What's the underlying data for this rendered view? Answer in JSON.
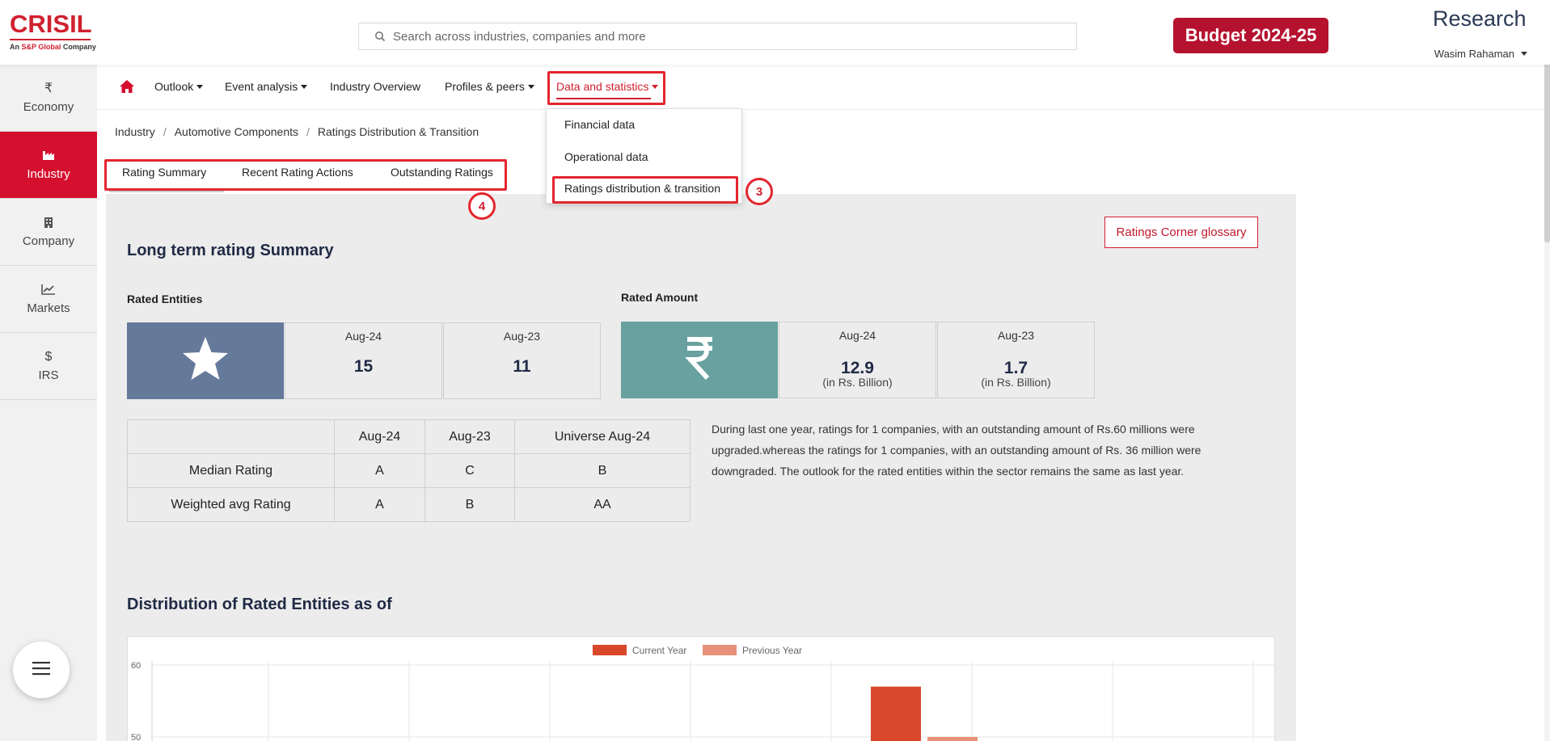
{
  "header": {
    "logo_text": "CRISIL",
    "logo_sub_prefix": "An ",
    "logo_sub_brand": "S&P Global",
    "logo_sub_suffix": " Company",
    "search_placeholder": "Search across industries, companies and more",
    "budget_label": "Budget 2024-25",
    "research_label": "Research",
    "user_name": "Wasim Rahaman"
  },
  "sidebar": {
    "items": [
      {
        "label": "Economy",
        "icon": "₹"
      },
      {
        "label": "Industry",
        "icon": "factory"
      },
      {
        "label": "Company",
        "icon": "building"
      },
      {
        "label": "Markets",
        "icon": "chart-line"
      },
      {
        "label": "IRS",
        "icon": "$"
      }
    ],
    "active": "Industry"
  },
  "nav": {
    "items": [
      {
        "label": "Outlook"
      },
      {
        "label": "Event analysis"
      },
      {
        "label": "Industry Overview"
      },
      {
        "label": "Profiles & peers"
      },
      {
        "label": "Data and statistics"
      }
    ],
    "active": "Data and statistics"
  },
  "dropdown": {
    "items": [
      {
        "label": "Financial data"
      },
      {
        "label": "Operational data"
      },
      {
        "label": "Ratings distribution & transition"
      }
    ]
  },
  "annotations": {
    "badge_dropdown": "3",
    "badge_tabs": "4",
    "highlight_color": "#e3262e"
  },
  "breadcrumb": [
    "Industry",
    "Automotive Components",
    "Ratings Distribution & Transition"
  ],
  "tabs": [
    {
      "label": "Rating Summary"
    },
    {
      "label": "Recent Rating Actions"
    },
    {
      "label": "Outstanding Ratings"
    }
  ],
  "content": {
    "glossary_label": "Ratings Corner glossary",
    "title": "Long term rating Summary",
    "rated_entities": {
      "label": "Rated Entities",
      "icon": "star-icon",
      "icon_bg": "#65799b",
      "cells": [
        {
          "period": "Aug-24",
          "value": "15"
        },
        {
          "period": "Aug-23",
          "value": "11"
        }
      ]
    },
    "rated_amount": {
      "label": "Rated Amount",
      "icon": "rupee-icon",
      "icon_bg": "#68a19f",
      "cells": [
        {
          "period": "Aug-24",
          "value": "12.9",
          "unit": "(in Rs. Billion)"
        },
        {
          "period": "Aug-23",
          "value": "1.7",
          "unit": "(in Rs. Billion)"
        }
      ]
    },
    "rating_table": {
      "headers": [
        "",
        "Aug-24",
        "Aug-23",
        "Universe Aug-24"
      ],
      "rows": [
        [
          "Median Rating",
          "A",
          "C",
          "B"
        ],
        [
          "Weighted avg Rating",
          "A",
          "B",
          "AA"
        ]
      ]
    },
    "summary": "During last one year, ratings for 1 companies, with an outstanding amount of Rs.60 millions were upgraded.whereas the ratings for 1 companies, with an outstanding amount of Rs. 36 million were downgraded. The outlook for the rated entities within the sector remains the same as last year.",
    "distribution_title": "Distribution of Rated Entities as of"
  },
  "chart_data": {
    "type": "bar",
    "legend": [
      "Current Year",
      "Previous Year"
    ],
    "legend_placement": "top-center",
    "colors": [
      "#d9472b",
      "#e8917a"
    ],
    "y_ticks": [
      "60",
      "50"
    ],
    "series": [
      {
        "name": "Current Year",
        "values": [
          57
        ]
      },
      {
        "name": "Previous Year",
        "values": [
          50
        ]
      }
    ],
    "grid": true
  }
}
